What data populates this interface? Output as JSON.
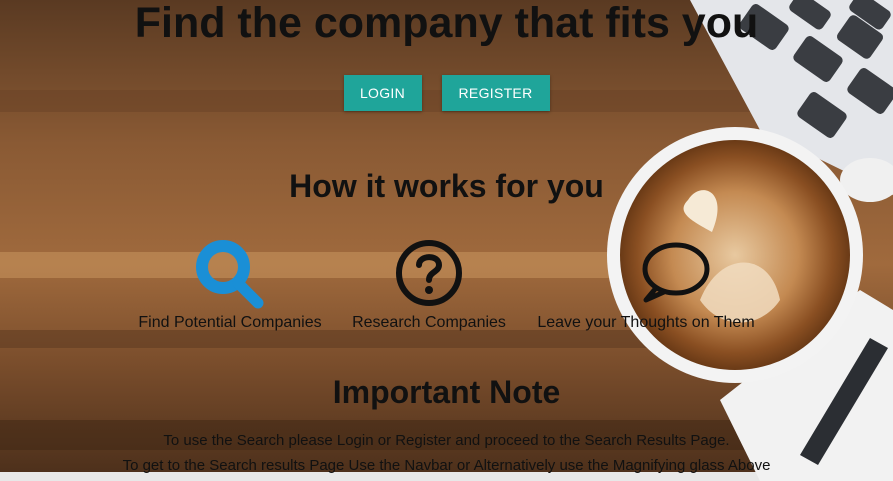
{
  "hero": {
    "title": "Find the company that fits you"
  },
  "auth": {
    "login_label": "LOGIN",
    "register_label": "REGISTER"
  },
  "how_it_works": {
    "title": "How it works for you",
    "features": [
      {
        "icon": "search-icon",
        "label": "Find Potential Companies"
      },
      {
        "icon": "question-circle-icon",
        "label": "Research Companies"
      },
      {
        "icon": "speech-bubble-icon",
        "label": "Leave your Thoughts on Them"
      }
    ]
  },
  "note": {
    "title": "Important Note",
    "lines": [
      "To use the Search please Login or Register and proceed to the Search Results Page.",
      "To get to the Search results Page Use the Navbar or Alternatively use the Magnifying glass Above"
    ]
  },
  "colors": {
    "accent": "#1fa59a",
    "search_icon": "#1a8fd6",
    "text": "#111111"
  }
}
